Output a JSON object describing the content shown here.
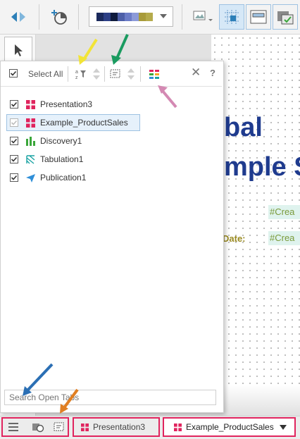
{
  "popup": {
    "select_all_label": "Select All",
    "close_label": "✕",
    "help_label": "?",
    "items": [
      {
        "name": "Presentation3",
        "checked": true,
        "icon": "presentation-icon"
      },
      {
        "name": "Example_ProductSales",
        "checked": true,
        "icon": "presentation-icon"
      },
      {
        "name": "Discovery1",
        "checked": true,
        "icon": "discovery-icon"
      },
      {
        "name": "Tabulation1",
        "checked": true,
        "icon": "tabulation-icon"
      },
      {
        "name": "Publication1",
        "checked": true,
        "icon": "publication-icon"
      }
    ],
    "search_placeholder": "Search Open Tabs"
  },
  "report": {
    "line1": "bal",
    "line2": "mple S",
    "created_field": "#Crea",
    "date_label": "Date:",
    "date_field": "#Crea"
  },
  "tabs": [
    {
      "label": "Presentation3",
      "active": false
    },
    {
      "label": "Example_ProductSales",
      "active": true
    }
  ],
  "colors": {
    "presentation": "#e0245e",
    "discovery": "#3aa63a",
    "tabulation": "#1aa3a3",
    "publication": "#2f8fd8",
    "tab_outline": "#e0245e",
    "report_title": "#1f3b8e"
  }
}
